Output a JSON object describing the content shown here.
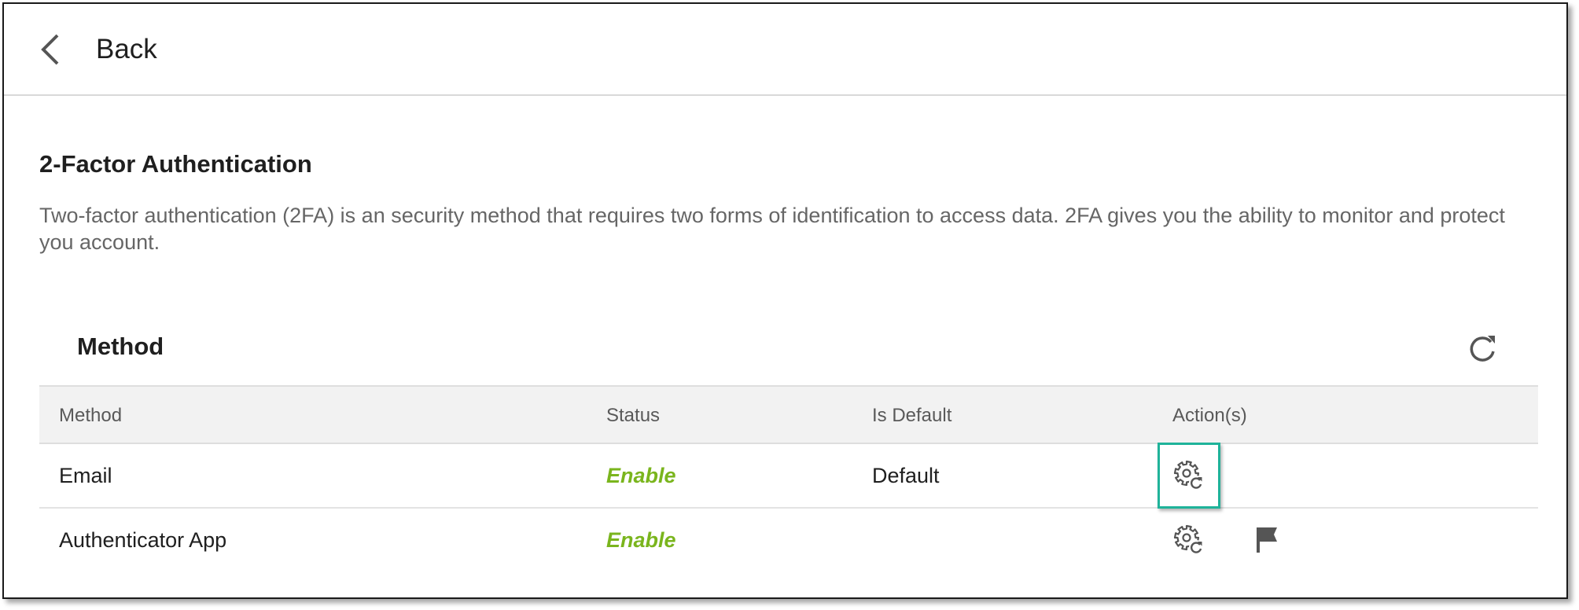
{
  "header": {
    "back_label": "Back"
  },
  "page": {
    "title": "2-Factor Authentication",
    "description": "Two-factor authentication (2FA) is an security method that requires two forms of identification to access data. 2FA gives you the ability to monitor and protect you account."
  },
  "methods_section": {
    "title": "Method",
    "columns": [
      "Method",
      "Status",
      "Is Default",
      "Action(s)"
    ],
    "rows": [
      {
        "method": "Email",
        "status": "Enable",
        "is_default": "Default",
        "actions": [
          "gear-refresh-icon"
        ]
      },
      {
        "method": "Authenticator App",
        "status": "Enable",
        "is_default": "",
        "actions": [
          "gear-refresh-icon",
          "flag-icon"
        ]
      }
    ]
  },
  "colors": {
    "status_enable": "#7ab51d",
    "highlight": "#1fb39a",
    "icon": "#555555"
  }
}
